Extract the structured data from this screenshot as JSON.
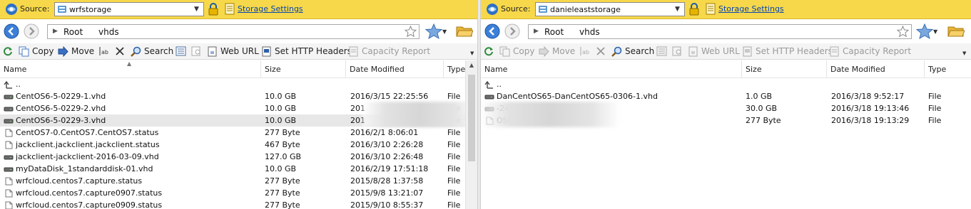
{
  "left": {
    "source_label": "Source:",
    "account": "wrfstorage",
    "storage_settings": "Storage Settings",
    "breadcrumb": [
      "Root",
      "vhds"
    ],
    "toolbar": {
      "copy": "Copy",
      "move": "Move",
      "search": "Search",
      "web_url": "Web URL",
      "set_http_headers": "Set HTTP Headers",
      "capacity_report": "Capacity Report"
    },
    "columns": {
      "name": "Name",
      "size": "Size",
      "date": "Date Modified",
      "type": "Type"
    },
    "parent_dir": "..",
    "rows": [
      {
        "icon": "disk-icon",
        "name": "CentOS6-5-0229-1.vhd",
        "size": "10.0 GB",
        "date": "2016/3/15 22:25:56",
        "type": "File"
      },
      {
        "icon": "disk-icon",
        "name": "CentOS6-5-0229-2.vhd",
        "size": "10.0 GB",
        "date": "201",
        "type": "File"
      },
      {
        "icon": "disk-icon",
        "name": "CentOS6-5-0229-3.vhd",
        "size": "10.0 GB",
        "date": "201",
        "type": "File",
        "selected": true
      },
      {
        "icon": "file-icon",
        "name": "CentOS7-0.CentOS7.CentOS7.status",
        "size": "277 Byte",
        "date": "2016/2/1 8:06:01",
        "type": "File"
      },
      {
        "icon": "file-icon",
        "name": "jackclient.jackclient.jackclient.status",
        "size": "467 Byte",
        "date": "2016/3/10 2:26:28",
        "type": "File"
      },
      {
        "icon": "disk-icon",
        "name": "jackclient-jackclient-2016-03-09.vhd",
        "size": "127.0 GB",
        "date": "2016/3/10 2:26:48",
        "type": "File"
      },
      {
        "icon": "disk-icon",
        "name": "myDataDisk_1standarddisk-01.vhd",
        "size": "10.0 GB",
        "date": "2016/2/19 17:51:18",
        "type": "File"
      },
      {
        "icon": "file-icon",
        "name": "wrfcloud.centos7.capture.status",
        "size": "277 Byte",
        "date": "2015/8/28 1:37:58",
        "type": "File"
      },
      {
        "icon": "file-icon",
        "name": "wrfcloud.centos7.capture0907.status",
        "size": "277 Byte",
        "date": "2015/9/8 13:21:07",
        "type": "File"
      },
      {
        "icon": "file-icon",
        "name": "wrfcloud.centos7.capture0909.status",
        "size": "277 Byte",
        "date": "2015/9/10 8:55:37",
        "type": "File"
      }
    ]
  },
  "right": {
    "source_label": "Source:",
    "account": "danieleaststorage",
    "storage_settings": "Storage Settings",
    "breadcrumb": [
      "Root",
      "vhds"
    ],
    "toolbar": {
      "copy": "Copy",
      "move": "Move",
      "search": "Search",
      "web_url": "Web URL",
      "set_http_headers": "Set HTTP Headers",
      "capacity_report": "Capacity Report"
    },
    "columns": {
      "name": "Name",
      "size": "Size",
      "date": "Date Modified",
      "type": "Type"
    },
    "parent_dir": "..",
    "rows": [
      {
        "icon": "disk-icon",
        "name": "DanCentOS65-DanCentOS65-0306-1.vhd",
        "size": "1.0 GB",
        "date": "2016/3/18 9:52:17",
        "type": "File"
      },
      {
        "icon": "disk-icon",
        "name": "-24.vhd",
        "size": "30.0 GB",
        "date": "2016/3/18 19:13:46",
        "type": "File"
      },
      {
        "icon": "file-icon",
        "name": "OS65.status",
        "size": "277 Byte",
        "date": "2016/3/18 19:13:29",
        "type": "File"
      }
    ]
  },
  "colors": {
    "source_bar": "#f7d84a",
    "link": "#0645ad",
    "selected_row": "#e7e7e7"
  }
}
